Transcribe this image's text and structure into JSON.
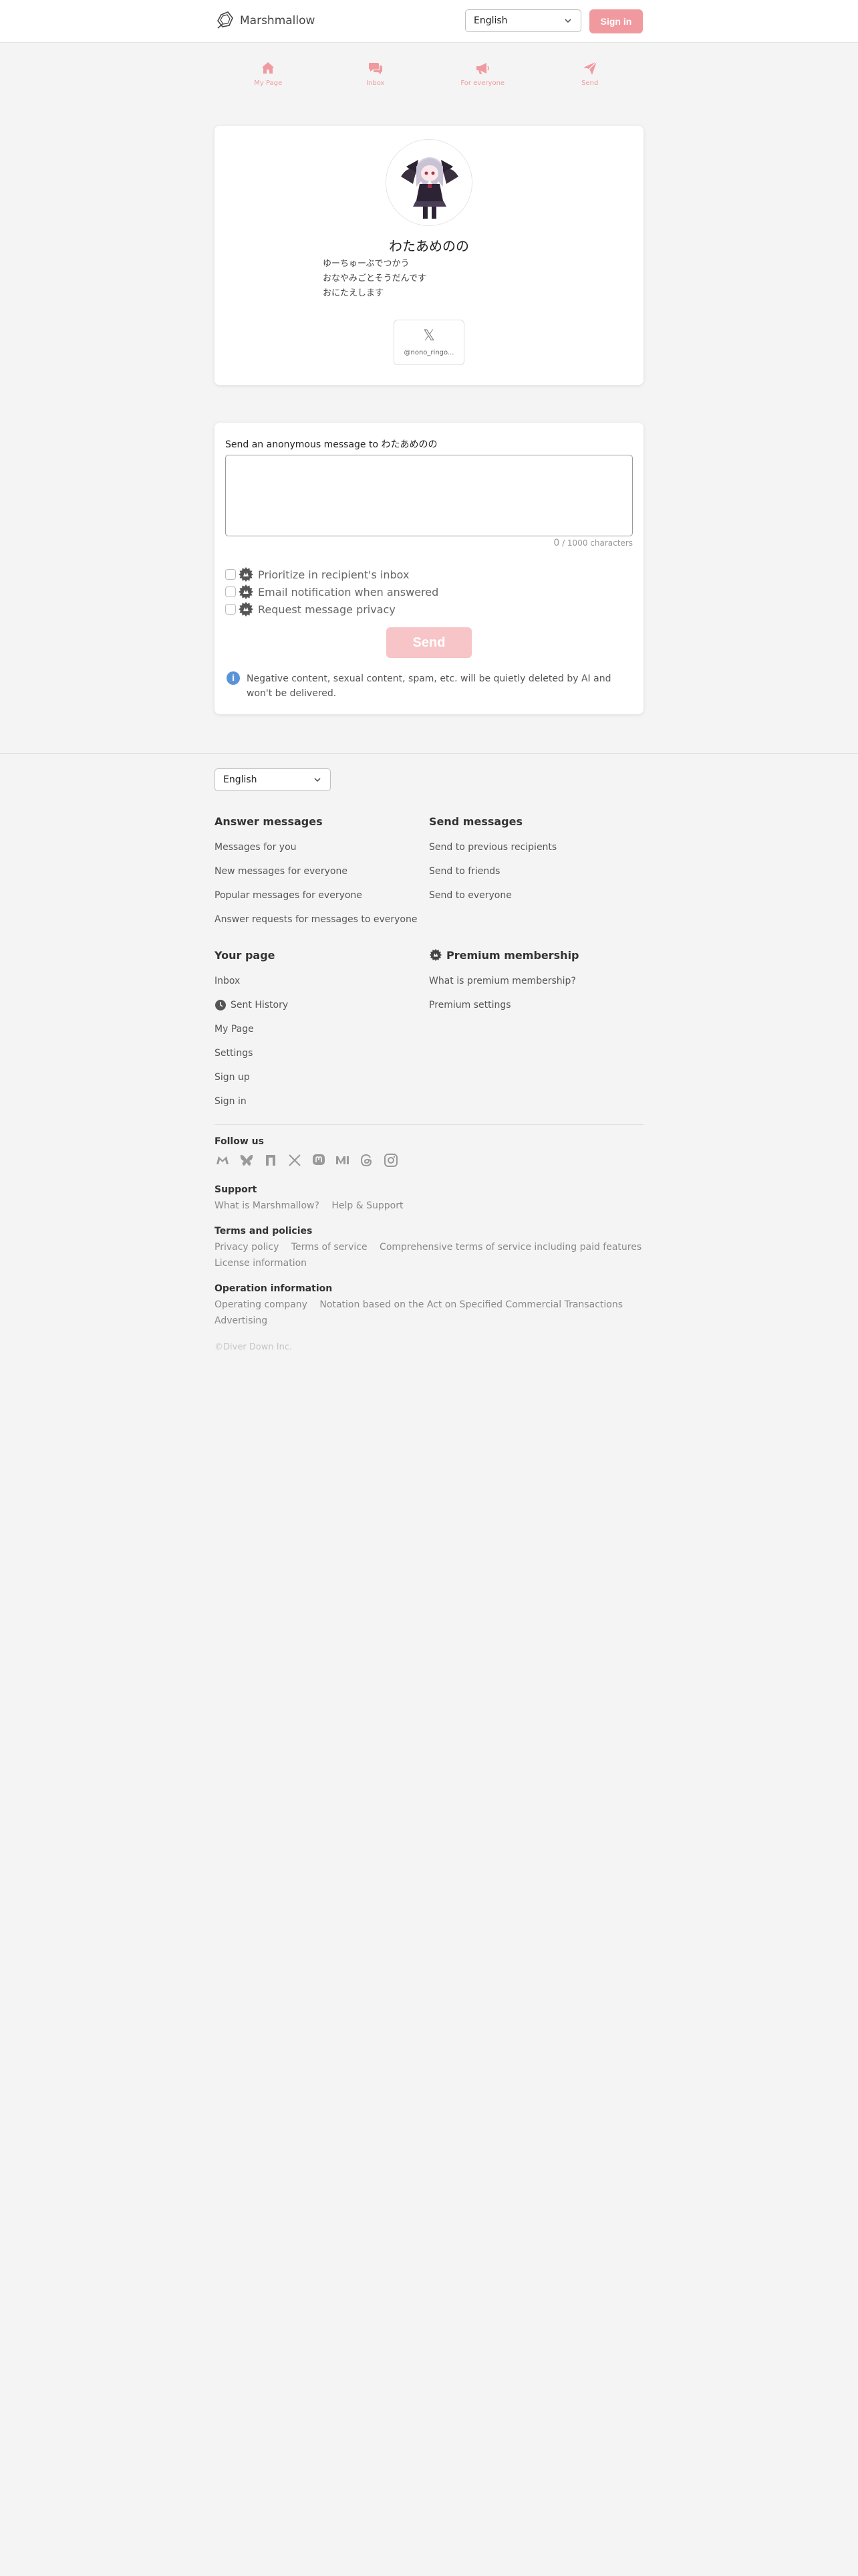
{
  "header": {
    "brand": "Marshmallow",
    "language": "English",
    "signin": "Sign in"
  },
  "nav": [
    {
      "label": "My Page",
      "icon": "home-icon"
    },
    {
      "label": "Inbox",
      "icon": "chat-bubbles-icon"
    },
    {
      "label": "For everyone",
      "icon": "megaphone-icon"
    },
    {
      "label": "Send",
      "icon": "paper-plane-icon"
    }
  ],
  "profile": {
    "name": "わたあめのの",
    "bio": [
      "ゆーちゅーぶでつかう",
      "おなやみごとそうだんです",
      "おにたえします"
    ],
    "x_handle": "@nono_ringo..."
  },
  "message": {
    "label": "Send an anonymous message to わたあめのの",
    "text": "",
    "char_count": "0",
    "char_suffix": "/ 1000 characters",
    "options": [
      {
        "label": "Prioritize in recipient's inbox",
        "checked": false
      },
      {
        "label": "Email notification when answered",
        "checked": false
      },
      {
        "label": "Request message privacy",
        "checked": false
      }
    ],
    "send": "Send",
    "notice": "Negative content, sexual content, spam, etc. will be quietly deleted by AI and won't be delivered."
  },
  "footer": {
    "language": "English",
    "answer": {
      "title": "Answer messages",
      "links": [
        "Messages for you",
        "New messages for everyone",
        "Popular messages for everyone",
        "Answer requests for messages to everyone"
      ]
    },
    "send": {
      "title": "Send messages",
      "links": [
        "Send to previous recipients",
        "Send to friends",
        "Send to everyone"
      ]
    },
    "page": {
      "title": "Your page",
      "links": [
        "Inbox",
        "Sent History",
        "My Page",
        "Settings",
        "Sign up",
        "Sign in"
      ]
    },
    "premium": {
      "title": "Premium membership",
      "links": [
        "What is premium membership?",
        "Premium settings"
      ]
    },
    "follow_title": "Follow us",
    "social_icons": [
      "misskey-icon",
      "bluesky-icon",
      "note-icon",
      "x-icon",
      "mastodon-icon",
      "medium-icon",
      "threads-icon",
      "instagram-icon"
    ],
    "support": {
      "title": "Support",
      "links": [
        "What is Marshmallow?",
        "Help & Support"
      ]
    },
    "terms": {
      "title": "Terms and policies",
      "links": [
        "Privacy policy",
        "Terms of service",
        "Comprehensive terms of service including paid features",
        "License information"
      ]
    },
    "operation": {
      "title": "Operation information",
      "links": [
        "Operating company",
        "Notation based on the Act on Specified Commercial Transactions",
        "Advertising"
      ]
    },
    "copyright": "©Diver Down Inc."
  },
  "colors": {
    "accent": "#f0999e",
    "accent_light": "#f7c4c7",
    "info": "#5b93d9"
  }
}
